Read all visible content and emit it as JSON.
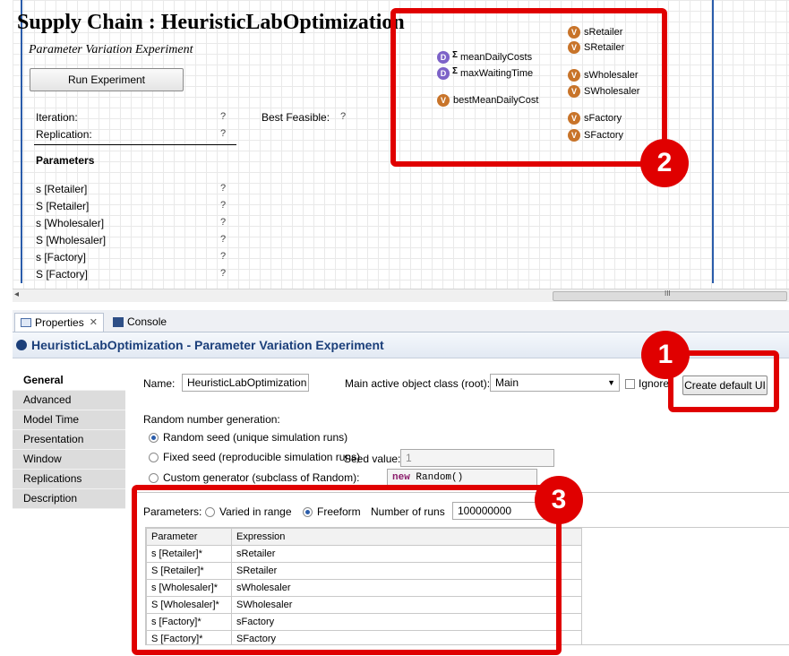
{
  "canvas": {
    "title": "Supply Chain : HeuristicLabOptimization",
    "subtitle": "Parameter Variation Experiment",
    "run_button": "Run Experiment",
    "iteration_label": "Iteration:",
    "iteration_value": "?",
    "replication_label": "Replication:",
    "replication_value": "?",
    "best_feasible_label": "Best Feasible:",
    "best_feasible_value": "?",
    "parameters_heading": "Parameters",
    "parameters": [
      {
        "name": "s [Retailer]",
        "value": "?"
      },
      {
        "name": "S [Retailer]",
        "value": "?"
      },
      {
        "name": "s [Wholesaler]",
        "value": "?"
      },
      {
        "name": "S [Wholesaler]",
        "value": "?"
      },
      {
        "name": "s [Factory]",
        "value": "?"
      },
      {
        "name": "S [Factory]",
        "value": "?"
      }
    ],
    "datasets": [
      "meanDailyCosts",
      "maxWaitingTime"
    ],
    "best_mean_daily_cost": "bestMeanDailyCost",
    "variables": [
      "sRetailer",
      "SRetailer",
      "sWholesaler",
      "SWholesaler",
      "sFactory",
      "SFactory"
    ],
    "scroll_marker": "III"
  },
  "callouts": {
    "one": "1",
    "two": "2",
    "three": "3"
  },
  "tabs": {
    "properties": "Properties",
    "console": "Console"
  },
  "heading": "HeuristicLabOptimization - Parameter Variation Experiment",
  "sidebar": [
    "General",
    "Advanced",
    "Model Time",
    "Presentation",
    "Window",
    "Replications",
    "Description"
  ],
  "form": {
    "name_label": "Name:",
    "name_value": "HeuristicLabOptimization",
    "main_class_label": "Main active object class (root):",
    "main_class_value": "Main",
    "ignore_label": "Ignore",
    "create_ui_button": "Create default UI",
    "rng_label": "Random number generation:",
    "rng_random": "Random seed (unique simulation runs)",
    "rng_fixed": "Fixed seed (reproducible simulation runs)",
    "seed_label": "Seed value:",
    "seed_value": "1",
    "rng_custom": "Custom generator (subclass of Random):",
    "custom_kw": "new",
    "custom_rest": " Random()",
    "params_label": "Parameters:",
    "varied_label": "Varied in range",
    "freeform_label": "Freeform",
    "runs_label": "Number of runs",
    "runs_value": "100000000"
  },
  "table": {
    "headers": [
      "Parameter",
      "Expression"
    ],
    "rows": [
      [
        "s [Retailer]*",
        "sRetailer"
      ],
      [
        "S [Retailer]*",
        "SRetailer"
      ],
      [
        "s [Wholesaler]*",
        "sWholesaler"
      ],
      [
        "S [Wholesaler]*",
        "SWholesaler"
      ],
      [
        "s [Factory]*",
        "sFactory"
      ],
      [
        "S [Factory]*",
        "SFactory"
      ]
    ]
  },
  "colors": {
    "callout": "#e00000",
    "variable_icon": "#c8742a",
    "dataset_icon": "#7d63c8",
    "heading_text": "#1b3f7a"
  }
}
